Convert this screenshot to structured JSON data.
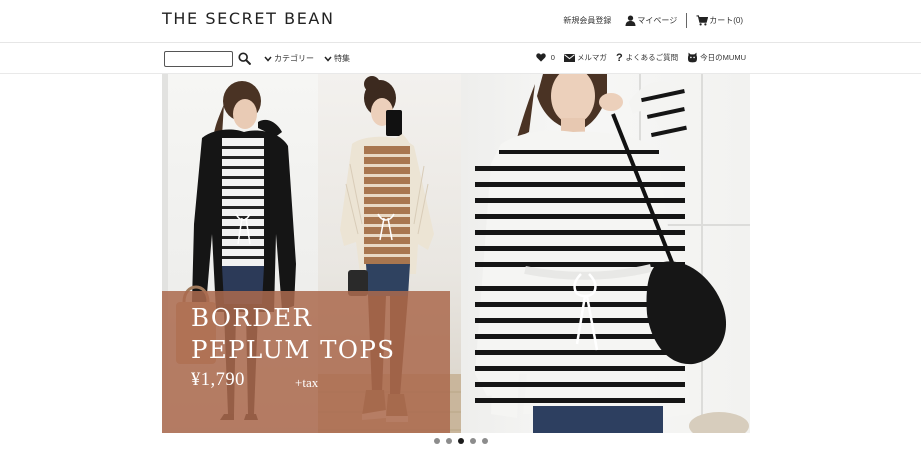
{
  "header": {
    "logo": "THE SECRET BEAN",
    "register": "新規会員登録",
    "mypage": "マイページ",
    "cart": "カート(0)"
  },
  "nav": {
    "search_placeholder": "",
    "category": "カテゴリー",
    "feature": "特集",
    "favorites_count": "0",
    "mailmag": "メルマガ",
    "faq": "よくあるご質問",
    "today": "今日のMUMU"
  },
  "hero": {
    "line1": "BORDER",
    "line2": "PEPLUM TOPS",
    "price": "¥1,790",
    "tax": "+tax"
  },
  "slider": {
    "total": 5,
    "active_index": 3
  },
  "colors": {
    "promo_overlay": "#ab6a4e",
    "dot_active": "#1c1c1c",
    "dot_inactive": "#8c8c8c"
  }
}
